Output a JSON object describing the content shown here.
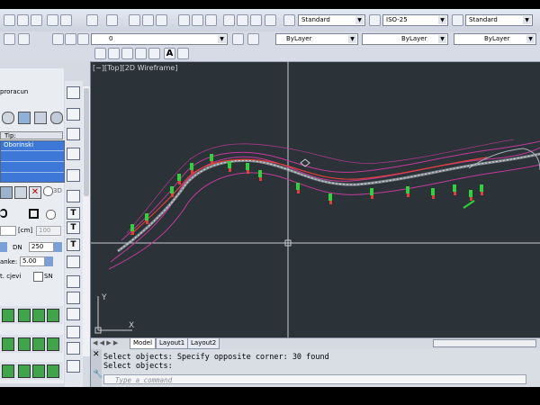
{
  "toolbar_top": {
    "text_style": "Standard",
    "dim_style": "ISO-25",
    "table_style": "Standard"
  },
  "toolbar_layer": {
    "layer_value": "0",
    "color": "ByLayer",
    "linetype": "ByLayer",
    "lineweight": "ByLayer"
  },
  "left_panel": {
    "title": "proracun",
    "grid_header": "Tip:",
    "grid_row": "Oborinski",
    "label_3d": "3D",
    "unit_cm": "[cm]",
    "value_100": "100",
    "label_dn": "DN",
    "value_dn": "250",
    "label_nke": "anke:",
    "value_nke": "5.00",
    "label_cjevi": "t. cjevi",
    "label_sn": "SN"
  },
  "viewport": {
    "label": "[−][Top][2D Wireframe]",
    "axis_y": "Y",
    "axis_x": "X"
  },
  "layout_tabs": [
    "Model",
    "Layout1",
    "Layout2"
  ],
  "command_line": {
    "line1": "Select objects: Specify opposite corner: 30 found",
    "line2": "Select objects:",
    "placeholder": "Type a command"
  }
}
